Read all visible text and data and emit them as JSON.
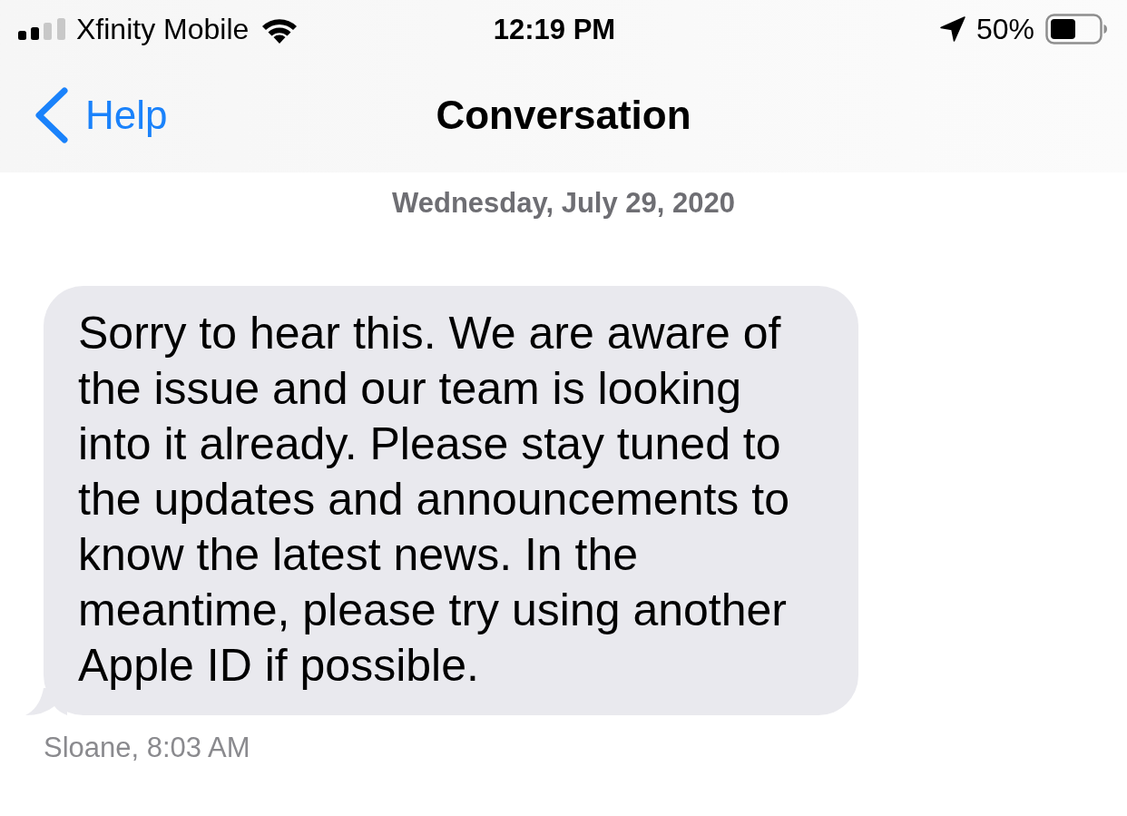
{
  "status_bar": {
    "carrier": "Xfinity Mobile",
    "time": "12:19 PM",
    "battery": "50%"
  },
  "nav_bar": {
    "back_label": "Help",
    "title": "Conversation"
  },
  "date_header": "Wednesday, July 29, 2020",
  "messages": [
    {
      "text": "Sorry to hear this. We are aware of the issue and our team is looking into it already. Please stay tuned to the updates and announcements to know the latest news. In the meantime, please try using another Apple ID if possible.",
      "sender_time": "Sloane, 8:03 AM"
    }
  ]
}
